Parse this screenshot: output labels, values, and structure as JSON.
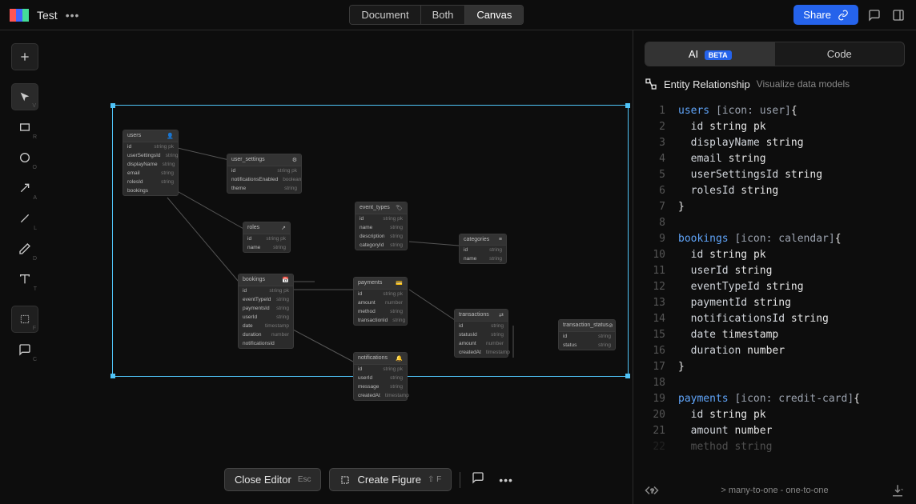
{
  "header": {
    "title": "Test",
    "views": [
      "Document",
      "Both",
      "Canvas"
    ],
    "active_view": "Canvas",
    "share": "Share"
  },
  "right_panel": {
    "tabs": {
      "ai": "AI",
      "beta": "BETA",
      "code": "Code"
    },
    "er_title": "Entity Relationship",
    "er_desc": "Visualize data models"
  },
  "code": {
    "lines": [
      {
        "n": 1,
        "seg": [
          [
            "entity",
            "users "
          ],
          [
            "ann",
            "[icon: user]"
          ],
          [
            "brace",
            "{"
          ]
        ]
      },
      {
        "n": 2,
        "seg": [
          [
            "pad",
            "  "
          ],
          [
            "key",
            "id "
          ],
          [
            "type",
            "string "
          ],
          [
            "pk",
            "pk"
          ]
        ]
      },
      {
        "n": 3,
        "seg": [
          [
            "pad",
            "  "
          ],
          [
            "key",
            "displayName "
          ],
          [
            "type",
            "string"
          ]
        ]
      },
      {
        "n": 4,
        "seg": [
          [
            "pad",
            "  "
          ],
          [
            "key",
            "email "
          ],
          [
            "type",
            "string"
          ]
        ]
      },
      {
        "n": 5,
        "seg": [
          [
            "pad",
            "  "
          ],
          [
            "key",
            "userSettingsId "
          ],
          [
            "type",
            "string"
          ]
        ]
      },
      {
        "n": 6,
        "seg": [
          [
            "pad",
            "  "
          ],
          [
            "key",
            "rolesId "
          ],
          [
            "type",
            "string"
          ]
        ]
      },
      {
        "n": 7,
        "seg": [
          [
            "brace",
            "}"
          ]
        ]
      },
      {
        "n": 8,
        "seg": []
      },
      {
        "n": 9,
        "seg": [
          [
            "entity",
            "bookings "
          ],
          [
            "ann",
            "[icon: calendar]"
          ],
          [
            "brace",
            "{"
          ]
        ]
      },
      {
        "n": 10,
        "seg": [
          [
            "pad",
            "  "
          ],
          [
            "key",
            "id "
          ],
          [
            "type",
            "string "
          ],
          [
            "pk",
            "pk"
          ]
        ]
      },
      {
        "n": 11,
        "seg": [
          [
            "pad",
            "  "
          ],
          [
            "key",
            "userId "
          ],
          [
            "type",
            "string"
          ]
        ]
      },
      {
        "n": 12,
        "seg": [
          [
            "pad",
            "  "
          ],
          [
            "key",
            "eventTypeId "
          ],
          [
            "type",
            "string"
          ]
        ]
      },
      {
        "n": 13,
        "seg": [
          [
            "pad",
            "  "
          ],
          [
            "key",
            "paymentId "
          ],
          [
            "type",
            "string"
          ]
        ]
      },
      {
        "n": 14,
        "seg": [
          [
            "pad",
            "  "
          ],
          [
            "key",
            "notificationsId "
          ],
          [
            "type",
            "string"
          ]
        ]
      },
      {
        "n": 15,
        "seg": [
          [
            "pad",
            "  "
          ],
          [
            "key",
            "date "
          ],
          [
            "type",
            "timestamp"
          ]
        ]
      },
      {
        "n": 16,
        "seg": [
          [
            "pad",
            "  "
          ],
          [
            "key",
            "duration "
          ],
          [
            "type",
            "number"
          ]
        ]
      },
      {
        "n": 17,
        "seg": [
          [
            "brace",
            "}"
          ]
        ]
      },
      {
        "n": 18,
        "seg": []
      },
      {
        "n": 19,
        "seg": [
          [
            "entity",
            "payments "
          ],
          [
            "ann",
            "[icon: credit-card]"
          ],
          [
            "brace",
            "{"
          ]
        ]
      },
      {
        "n": 20,
        "seg": [
          [
            "pad",
            "  "
          ],
          [
            "key",
            "id "
          ],
          [
            "type",
            "string "
          ],
          [
            "pk",
            "pk"
          ]
        ]
      },
      {
        "n": 21,
        "seg": [
          [
            "pad",
            "  "
          ],
          [
            "key",
            "amount "
          ],
          [
            "type",
            "number"
          ]
        ]
      }
    ],
    "truncated": "method string"
  },
  "hints": "> many-to-one  -  one-to-one",
  "entities": {
    "users": {
      "name": "users",
      "rows": [
        [
          "id",
          "string pk"
        ],
        [
          "userSettingsId",
          "string"
        ],
        [
          "displayName",
          "string"
        ],
        [
          "email",
          "string"
        ],
        [
          "rolesId",
          "string"
        ],
        [
          "bookings",
          ""
        ]
      ]
    },
    "user_settings": {
      "name": "user_settings",
      "rows": [
        [
          "id",
          "string pk"
        ],
        [
          "notificationsEnabled",
          "boolean"
        ],
        [
          "theme",
          "string"
        ]
      ]
    },
    "roles": {
      "name": "roles",
      "rows": [
        [
          "id",
          "string pk"
        ],
        [
          "name",
          "string"
        ]
      ]
    },
    "event_types": {
      "name": "event_types",
      "rows": [
        [
          "id",
          "string pk"
        ],
        [
          "name",
          "string"
        ],
        [
          "description",
          "string"
        ],
        [
          "categoryId",
          "string"
        ]
      ]
    },
    "categories": {
      "name": "categories",
      "rows": [
        [
          "id",
          "string"
        ],
        [
          "name",
          "string"
        ]
      ]
    },
    "bookings": {
      "name": "bookings",
      "rows": [
        [
          "id",
          "string pk"
        ],
        [
          "eventTypeId",
          "string"
        ],
        [
          "paymentsId",
          "string"
        ],
        [
          "userId",
          "string"
        ],
        [
          "date",
          "timestamp"
        ],
        [
          "duration",
          "number"
        ],
        [
          "notificationsId",
          ""
        ]
      ]
    },
    "payments": {
      "name": "payments",
      "rows": [
        [
          "id",
          "string pk"
        ],
        [
          "amount",
          "number"
        ],
        [
          "method",
          "string"
        ],
        [
          "transactionId",
          "string"
        ]
      ]
    },
    "transactions": {
      "name": "transactions",
      "rows": [
        [
          "id",
          "string"
        ],
        [
          "statusId",
          "string"
        ],
        [
          "amount",
          "number"
        ],
        [
          "createdAt",
          "timestamp"
        ]
      ]
    },
    "transaction_status": {
      "name": "transaction_status",
      "rows": [
        [
          "id",
          "string"
        ],
        [
          "status",
          "string"
        ]
      ]
    },
    "notifications": {
      "name": "notifications",
      "rows": [
        [
          "id",
          "string pk"
        ],
        [
          "userId",
          "string"
        ],
        [
          "message",
          "string"
        ],
        [
          "createdAt",
          "timestamp"
        ]
      ]
    }
  },
  "bottom": {
    "close": "Close Editor",
    "close_key": "Esc",
    "create": "Create Figure",
    "create_key": "⇧ F"
  }
}
